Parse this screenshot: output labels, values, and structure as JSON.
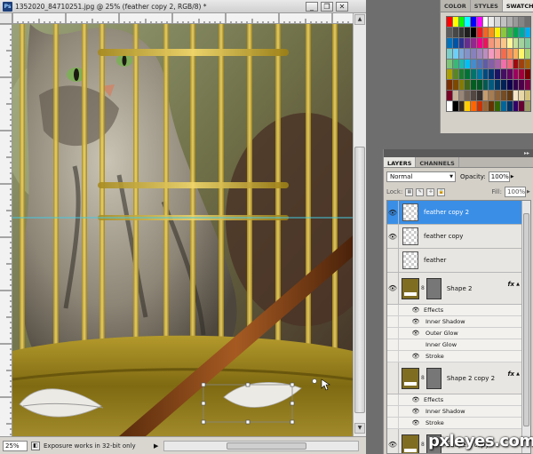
{
  "document": {
    "title": "1352020_84710251.jpg @ 25% (feather copy 2, RGB/8) *",
    "minimize_glyph": "_",
    "restore_glyph": "❐",
    "close_glyph": "✕",
    "zoom": "25%",
    "status_text": "Exposure works in 32-bit only",
    "status_arrow": "▶"
  },
  "swatches": {
    "tabs": [
      "COLOR",
      "STYLES",
      "SWATCHES"
    ],
    "active_tab": 2,
    "colors": [
      "#ff0000",
      "#ffff00",
      "#00ff00",
      "#00ffff",
      "#0000ff",
      "#ff00ff",
      "#ffffff",
      "#ebebeb",
      "#d6d6d6",
      "#c2c2c2",
      "#adadad",
      "#999999",
      "#858585",
      "#707070",
      "#5c5c5c",
      "#474747",
      "#333333",
      "#1f1f1f",
      "#000000",
      "#ed1c24",
      "#f26522",
      "#f7941d",
      "#fff200",
      "#8dc63f",
      "#39b54a",
      "#00a651",
      "#00a99d",
      "#00aeef",
      "#0072bc",
      "#0054a6",
      "#2e3192",
      "#662d91",
      "#92278f",
      "#ec008c",
      "#ed145b",
      "#f7977a",
      "#f9ad81",
      "#fdc689",
      "#fff799",
      "#c4df9b",
      "#a3d39c",
      "#82ca9d",
      "#7bcdc8",
      "#6dcff6",
      "#7da7d9",
      "#8393ca",
      "#8781bd",
      "#a186be",
      "#bd8cbf",
      "#f49ac1",
      "#f6989d",
      "#f26c4f",
      "#f68e56",
      "#fbaf5d",
      "#fff568",
      "#acd373",
      "#7cc576",
      "#3bb878",
      "#1abbb4",
      "#00bff3",
      "#448ccb",
      "#5674b9",
      "#605ca8",
      "#8560a8",
      "#a864a8",
      "#f06eaa",
      "#f16d7e",
      "#9e0b0f",
      "#a0410d",
      "#a36209",
      "#aba000",
      "#598527",
      "#197b30",
      "#007236",
      "#00746b",
      "#0076a3",
      "#004a80",
      "#003471",
      "#1b1464",
      "#440e62",
      "#630460",
      "#9e005d",
      "#9e0039",
      "#790000",
      "#7b2e00",
      "#7d4900",
      "#827b00",
      "#406618",
      "#005e20",
      "#005826",
      "#005952",
      "#005b7f",
      "#003663",
      "#002157",
      "#0d004c",
      "#32004b",
      "#4b0049",
      "#7b0046",
      "#7a0026",
      "#c7b299",
      "#998675",
      "#736357",
      "#534741",
      "#362f2d",
      "#c69c6d",
      "#a67c52",
      "#8c6239",
      "#754c24",
      "#603913",
      "#f5e6c8",
      "#e8d8a8",
      "#d4c27a",
      "#ffffff",
      "#000000",
      "#3a2a1a",
      "#ffcc00",
      "#ff6600",
      "#cc3300",
      "#996633",
      "#663300",
      "#336600",
      "#006699",
      "#003366",
      "#330066",
      "#660033",
      "#999966"
    ]
  },
  "layers_panel": {
    "tabs": [
      "LAYERS",
      "CHANNELS"
    ],
    "active_tab": 0,
    "collapse_glyph": "▸▸",
    "blend_mode": "Normal",
    "opacity_label": "Opacity:",
    "opacity": "100%",
    "lock_label": "Lock:",
    "fill_label": "Fill:",
    "fill": "100%",
    "eye_glyph": "👁",
    "chain_glyph": "8",
    "fx_label": "fx",
    "effects_label": "Effects",
    "layers": [
      {
        "name": "feather copy 2",
        "selected": true,
        "visible": true,
        "kind": "pixel"
      },
      {
        "name": "feather copy",
        "selected": false,
        "visible": true,
        "kind": "pixel"
      },
      {
        "name": "feather",
        "selected": false,
        "visible": false,
        "kind": "pixel"
      },
      {
        "name": "Shape 2",
        "selected": false,
        "visible": true,
        "kind": "shape",
        "effects": [
          {
            "name": "Inner Shadow",
            "visible": true
          },
          {
            "name": "Outer Glow",
            "visible": true
          },
          {
            "name": "Inner Glow",
            "visible": false
          },
          {
            "name": "Stroke",
            "visible": true
          }
        ]
      },
      {
        "name": "Shape 2 copy 2",
        "selected": false,
        "visible": false,
        "kind": "shape",
        "effects": [
          {
            "name": "Inner Shadow",
            "visible": true
          },
          {
            "name": "Stroke",
            "visible": true
          }
        ]
      },
      {
        "name": "Shape 2 copy",
        "selected": false,
        "visible": true,
        "kind": "shape"
      }
    ]
  },
  "watermark": "pxleyes.com"
}
